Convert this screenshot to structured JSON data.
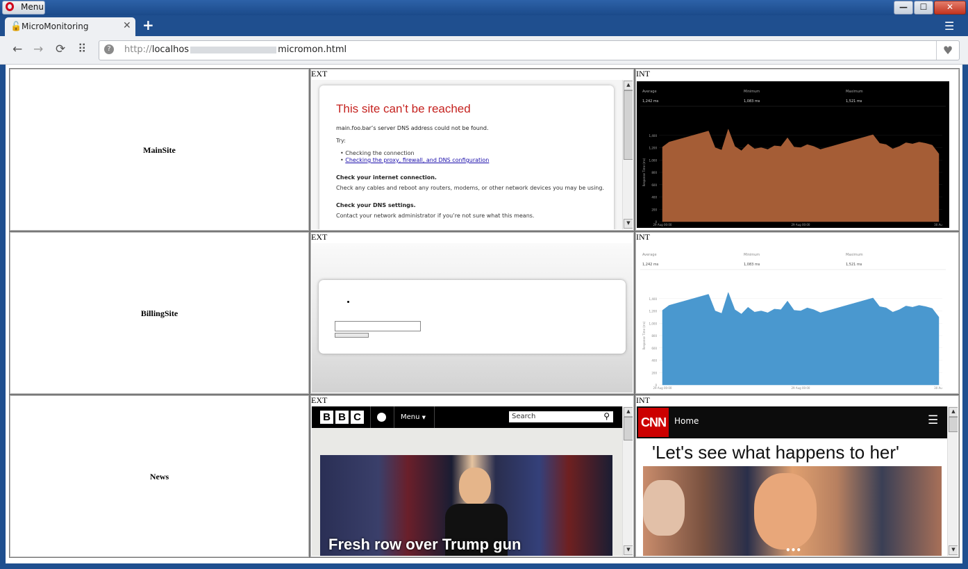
{
  "window": {
    "menu_label": "Menu",
    "min_label": "—",
    "max_label": "☐",
    "close_label": "✕"
  },
  "tab": {
    "title": "MicroMonitoring",
    "close": "✕",
    "new_tab": "+"
  },
  "toolbar": {
    "back": "←",
    "forward": "→",
    "reload": "⟳",
    "speed_dial": "⠿",
    "url_prefix": "http://",
    "url_host": "localhos",
    "url_path": "micromon.html",
    "heart": "♥",
    "globe": "?"
  },
  "grid": {
    "rows": [
      {
        "name": "MainSite",
        "ext_label": "EXT",
        "int_label": "INT"
      },
      {
        "name": "BillingSite",
        "ext_label": "EXT",
        "int_label": "INT"
      },
      {
        "name": "News",
        "ext_label": "EXT",
        "int_label": "INT"
      }
    ]
  },
  "error_page": {
    "title": "This site can’t be reached",
    "line1": "main.foo.bar’s server DNS address could not be found.",
    "try": "Try:",
    "bullet1": "Checking the connection",
    "bullet2": "Checking the proxy, firewall, and DNS configuration",
    "h2": "Check your internet connection.",
    "p2": "Check any cables and reboot any routers, modems, or other network devices you may be using.",
    "h3": "Check your DNS settings.",
    "p3": "Contact your network administrator if you’re not sure what this means."
  },
  "chart_common": {
    "stats": [
      {
        "label": "Average",
        "value": "1,242 ms"
      },
      {
        "label": "Minimum",
        "value": "1,083 ms"
      },
      {
        "label": "Maximum",
        "value": "1,521 ms"
      }
    ],
    "ylabel": "Response Time (ms)",
    "x_ticks": [
      "29 Aug 00:00",
      "29 Aug 00:00",
      "30 Au"
    ],
    "y_ticks": [
      "0",
      "200",
      "400",
      "600",
      "800",
      "1,000",
      "1,200",
      "1,400"
    ]
  },
  "chart_data": [
    {
      "type": "area",
      "theme": "dark",
      "fill": "#a55d36",
      "ylim": [
        0,
        1600
      ],
      "ylabel": "Response Time (ms)",
      "x_ticks": [
        "29 Aug 00:00",
        "29 Aug 00:00",
        "30 Au"
      ],
      "values": [
        1210,
        1290,
        1320,
        1350,
        1380,
        1410,
        1440,
        1470,
        1200,
        1160,
        1500,
        1220,
        1150,
        1260,
        1180,
        1200,
        1170,
        1230,
        1220,
        1360,
        1210,
        1200,
        1250,
        1220,
        1170,
        1200,
        1230,
        1260,
        1290,
        1320,
        1350,
        1380,
        1410,
        1270,
        1250,
        1180,
        1220,
        1280,
        1260,
        1290,
        1270,
        1240,
        1100
      ]
    },
    {
      "type": "area",
      "theme": "light",
      "fill": "#4a98cf",
      "ylim": [
        0,
        1600
      ],
      "ylabel": "Response Time (ms)",
      "x_ticks": [
        "29 Aug 00:00",
        "29 Aug 00:00",
        "30 Au"
      ],
      "values": [
        1210,
        1290,
        1320,
        1350,
        1380,
        1410,
        1440,
        1470,
        1200,
        1160,
        1500,
        1220,
        1150,
        1260,
        1180,
        1200,
        1170,
        1230,
        1220,
        1360,
        1210,
        1200,
        1250,
        1220,
        1170,
        1200,
        1230,
        1260,
        1290,
        1320,
        1350,
        1380,
        1410,
        1270,
        1250,
        1180,
        1220,
        1280,
        1260,
        1290,
        1270,
        1240,
        1100
      ]
    }
  ],
  "bbc": {
    "letters": [
      "B",
      "B",
      "C"
    ],
    "menu": "Menu",
    "search_placeholder": "Search",
    "headline": "Fresh row over Trump gun"
  },
  "cnn": {
    "logo": "CNN",
    "home": "Home",
    "headline": "'Let's see what happens to her'",
    "dots": "•••"
  },
  "colors": {
    "chrome_blue": "#1f4f8f",
    "error_red": "#c5221f",
    "cnn_red": "#cc0000"
  }
}
